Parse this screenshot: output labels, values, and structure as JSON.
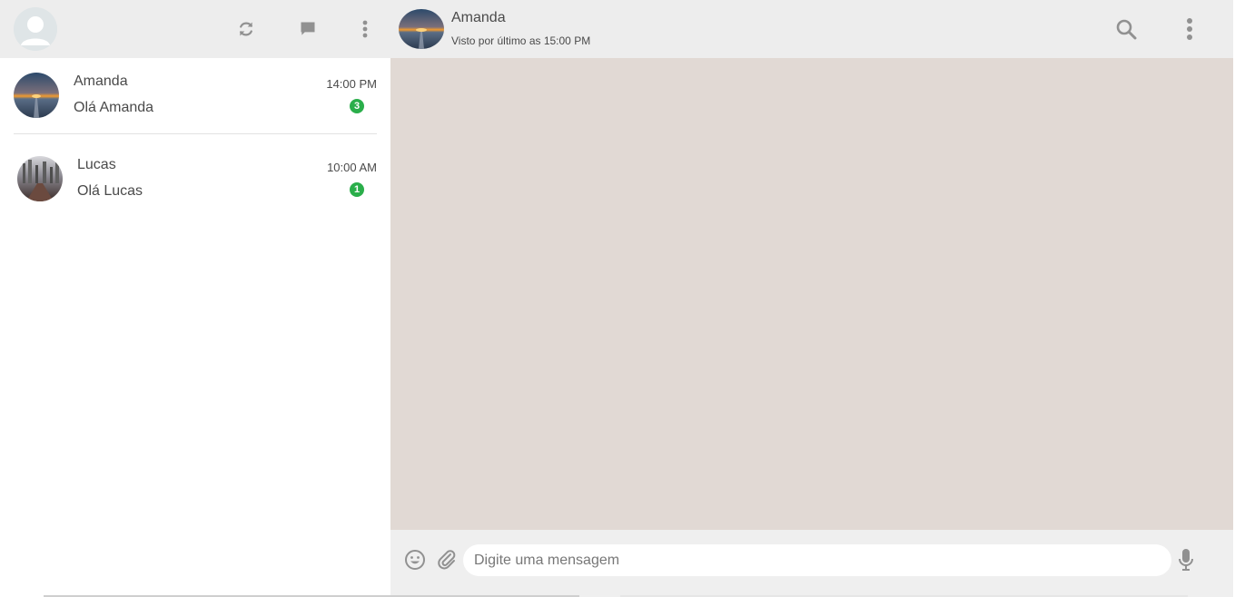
{
  "sidebar": {
    "header": {
      "icons": [
        "refresh-icon",
        "new-chat-icon",
        "menu-dots-icon"
      ]
    },
    "chats": [
      {
        "name": "Amanda",
        "preview": "Olá Amanda",
        "time": "14:00 PM",
        "unread": "3"
      },
      {
        "name": "Lucas",
        "preview": "Olá Lucas",
        "time": "10:00 AM",
        "unread": "1"
      }
    ]
  },
  "main": {
    "contact": {
      "name": "Amanda",
      "status": "Visto por último as 15:00 PM"
    },
    "composer": {
      "placeholder": "Digite uma mensagem"
    }
  },
  "colors": {
    "header_bg": "#ededed",
    "chat_bg": "#e1d9d4",
    "badge": "#2aae4a",
    "icon": "#919191"
  }
}
